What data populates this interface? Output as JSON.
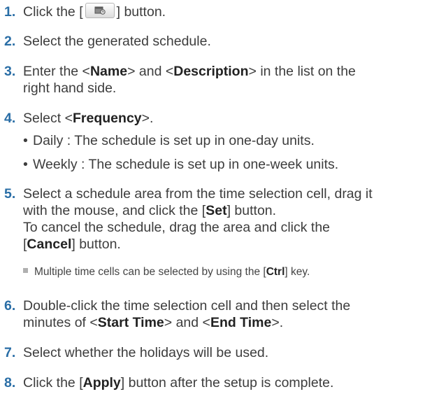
{
  "steps": [
    {
      "num": "1.",
      "pre": "Click the [",
      "post": "] button.",
      "icon": "schedule-icon"
    },
    {
      "num": "2.",
      "text": "Select the generated schedule."
    },
    {
      "num": "3.",
      "pre": "Enter the <",
      "b1": "Name",
      "mid": "> and <",
      "b2": "Description",
      "post": "> in the list on the",
      "line2": "right hand side."
    },
    {
      "num": "4.",
      "pre": "Select <",
      "b1": "Frequency",
      "post": ">."
    },
    {
      "num": "5.",
      "line1": "Select a schedule area from the time selection cell, drag it",
      "l2pre": "with the mouse, and click the [",
      "l2b": "Set",
      "l2post": "] button.",
      "line3": "To cancel the schedule, drag the area and click the",
      "l4pre": "[",
      "l4b": "Cancel",
      "l4post": "] button."
    },
    {
      "num": "6.",
      "line1": "Double-click the time selection cell and then select the",
      "l2pre": "minutes of <",
      "l2b1": "Start Time",
      "l2mid": "> and <",
      "l2b2": "End Time",
      "l2post": ">."
    },
    {
      "num": "7.",
      "text": "Select whether the holidays will be used."
    },
    {
      "num": "8.",
      "pre": "Click the [",
      "b1": "Apply",
      "post": "] button after the setup is complete."
    }
  ],
  "bullets": [
    "Daily : The schedule is set up in one-day units.",
    "Weekly : The schedule is set up in one-week units."
  ],
  "bullet_char": "•",
  "note": {
    "pre": "Multiple time cells can be selected by using the [",
    "b": "Ctrl",
    "post": "] key."
  },
  "colors": {
    "step_number": "#2a6ea6",
    "text": "#3d3d3d"
  }
}
